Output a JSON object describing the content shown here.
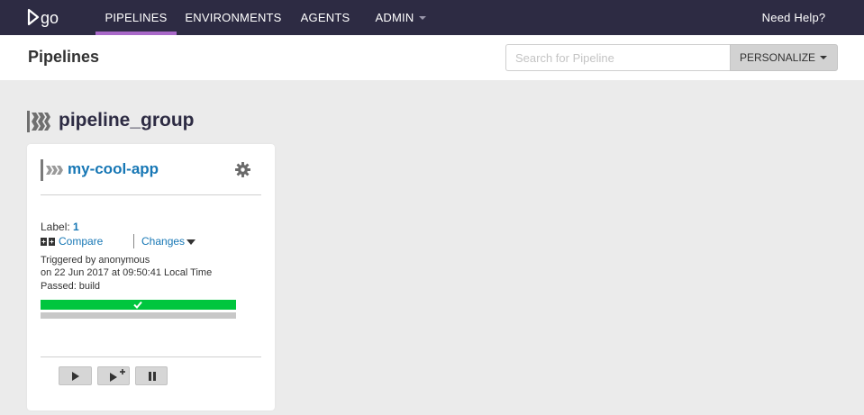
{
  "nav": {
    "items": [
      {
        "label": "PIPELINES",
        "active": true
      },
      {
        "label": "ENVIRONMENTS"
      },
      {
        "label": "AGENTS"
      },
      {
        "label": "ADMIN",
        "dropdown": true
      }
    ],
    "help": "Need Help?",
    "logo_text": "go"
  },
  "header": {
    "title": "Pipelines",
    "search_placeholder": "Search for Pipeline",
    "personalize_label": "PERSONALIZE"
  },
  "group": {
    "name": "pipeline_group",
    "pipeline": {
      "name": "my-cool-app",
      "label_prefix": "Label:",
      "label_value": "1",
      "compare_label": "Compare",
      "changes_label": "Changes",
      "triggered_by": "Triggered by anonymous",
      "triggered_on": "on 22 Jun 2017 at 09:50:41 Local Time",
      "stage_status": "Passed: build"
    }
  },
  "colors": {
    "nav_bg": "#2d2b43",
    "active_underline": "#a868c8",
    "link": "#1777b5",
    "passed": "#00c63e"
  },
  "icons": [
    "go-logo-icon",
    "chevron-down-icon",
    "pipeline-group-icon",
    "pipeline-icon",
    "gear-icon",
    "compare-icon",
    "checkmark-icon",
    "play-icon",
    "play-with-options-icon",
    "pause-icon"
  ]
}
